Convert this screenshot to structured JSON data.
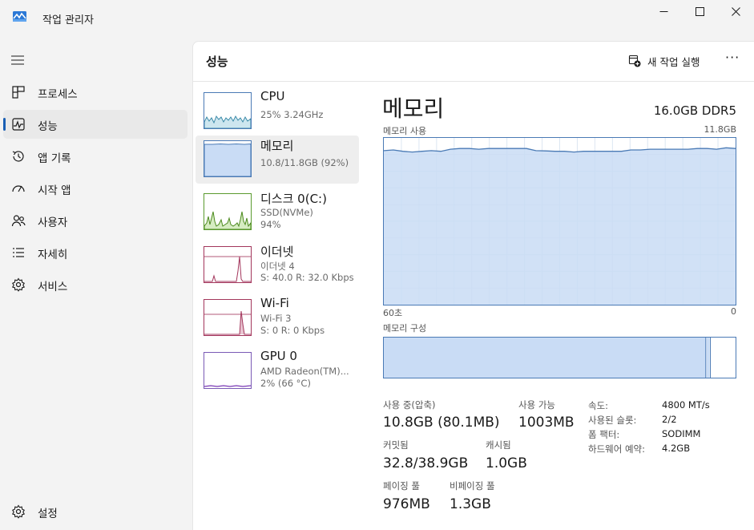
{
  "window": {
    "title": "작업 관리자"
  },
  "nav": {
    "items": [
      {
        "label": "프로세스",
        "icon": "processes-icon"
      },
      {
        "label": "성능",
        "icon": "performance-icon"
      },
      {
        "label": "앱 기록",
        "icon": "app-history-icon"
      },
      {
        "label": "시작 앱",
        "icon": "startup-icon"
      },
      {
        "label": "사용자",
        "icon": "users-icon"
      },
      {
        "label": "자세히",
        "icon": "details-icon"
      },
      {
        "label": "서비스",
        "icon": "services-icon"
      }
    ],
    "settings": "설정"
  },
  "header": {
    "title": "성능",
    "run_task": "새 작업 실행",
    "more": "···"
  },
  "devices": [
    {
      "name": "CPU",
      "sub1": "25% 3.24GHz",
      "sub2": "",
      "sub3": ""
    },
    {
      "name": "메모리",
      "sub1": "10.8/11.8GB (92%)",
      "sub2": "",
      "sub3": ""
    },
    {
      "name": "디스크 0(C:)",
      "sub1": "SSD(NVMe)",
      "sub2": "94%",
      "sub3": ""
    },
    {
      "name": "이더넷",
      "sub1": "이더넷 4",
      "sub2": "S: 40.0  R: 32.0 Kbps",
      "sub3": ""
    },
    {
      "name": "Wi-Fi",
      "sub1": "Wi-Fi 3",
      "sub2": "S: 0  R: 0 Kbps",
      "sub3": ""
    },
    {
      "name": "GPU 0",
      "sub1": "AMD Radeon(TM)...",
      "sub2": "2% (66 °C)",
      "sub3": ""
    }
  ],
  "detail": {
    "title": "메모리",
    "spec": "16.0GB DDR5",
    "usage_label": "메모리 사용",
    "usage_max": "11.8GB",
    "time_left": "60초",
    "time_right": "0",
    "composition_label": "메모리 구성",
    "stats": {
      "in_use_label": "사용 중(압축)",
      "in_use_value": "10.8GB (80.1MB)",
      "available_label": "사용 가능",
      "available_value": "1003MB",
      "committed_label": "커밋됨",
      "committed_value": "32.8/38.9GB",
      "cached_label": "캐시됨",
      "cached_value": "1.0GB",
      "paged_label": "페이징 풀",
      "paged_value": "976MB",
      "nonpaged_label": "비페이징 풀",
      "nonpaged_value": "1.3GB"
    },
    "props": [
      {
        "key": "속도:",
        "value": "4800 MT/s"
      },
      {
        "key": "사용된 슬롯:",
        "value": "2/2"
      },
      {
        "key": "폼 팩터:",
        "value": "SODIMM"
      },
      {
        "key": "하드웨어 예약:",
        "value": "4.2GB"
      }
    ]
  },
  "colors": {
    "accent": "#1a5fb4",
    "graph_border": "#4a7ab5",
    "memory_fill": "#c9dcf5"
  },
  "chart_data": {
    "type": "area",
    "title": "메모리 사용",
    "ylim": [
      0,
      11.8
    ],
    "x_range_seconds": [
      60,
      0
    ],
    "memory_usage_gb": [
      10.9,
      10.95,
      10.85,
      10.8,
      10.85,
      10.9,
      10.85,
      11.0,
      11.05,
      11.05,
      11.0,
      11.05,
      11.05,
      11.05,
      11.05,
      11.05,
      10.9,
      10.88,
      10.85,
      10.85,
      10.8,
      10.85,
      10.85,
      10.85,
      10.85,
      10.85,
      10.95,
      10.95,
      11.0,
      11.0,
      11.0,
      11.0,
      11.0,
      11.05,
      11.05,
      11.0,
      11.1,
      11.05
    ],
    "composition": {
      "in_use_gb": 10.8,
      "modified_gb": 0.1,
      "standby_gb": 1.0,
      "total_gb": 11.8
    }
  }
}
